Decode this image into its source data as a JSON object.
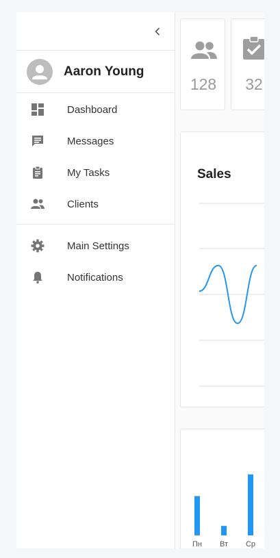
{
  "sidebar": {
    "user_name": "Aaron Young",
    "menu_primary": [
      {
        "label": "Dashboard",
        "icon": "dashboard-icon"
      },
      {
        "label": "Messages",
        "icon": "message-icon"
      },
      {
        "label": "My Tasks",
        "icon": "assignment-icon"
      },
      {
        "label": "Clients",
        "icon": "people-icon"
      }
    ],
    "menu_secondary": [
      {
        "label": "Main Settings",
        "icon": "gear-icon"
      },
      {
        "label": "Notifications",
        "icon": "bell-icon"
      }
    ]
  },
  "stats": [
    {
      "value": "128",
      "icon": "people-icon"
    },
    {
      "value": "32",
      "icon": "assignment-done-icon"
    }
  ],
  "sales": {
    "title": "Sales"
  },
  "colors": {
    "accent": "#2196f3",
    "icon": "#757575",
    "stat_icon": "#9e9e9e"
  },
  "chart_data": [
    {
      "type": "line",
      "title": "Sales",
      "series": [
        {
          "values": [
            0.1,
            0.9,
            -0.9,
            0.9
          ]
        }
      ],
      "grid": true
    },
    {
      "type": "bar",
      "categories": [
        "Пн",
        "Вт",
        "Ср"
      ],
      "values": [
        58,
        14,
        90
      ]
    }
  ]
}
